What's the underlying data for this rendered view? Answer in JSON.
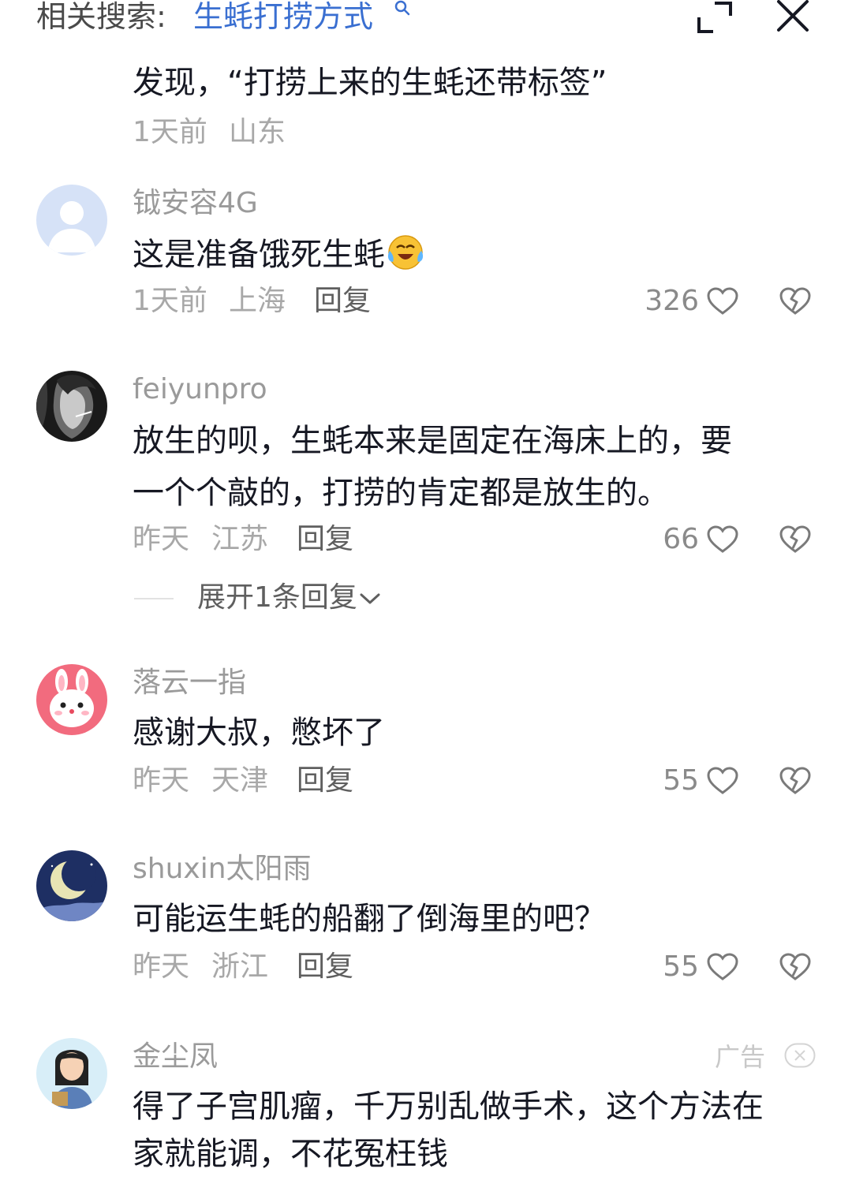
{
  "header": {
    "label": "相关搜索:",
    "query": "生蚝打捞方式",
    "icons": [
      "search-icon",
      "expand-icon",
      "close-icon"
    ]
  },
  "prev_comment": {
    "text": "发现，“打捞上来的生蚝还带标签”",
    "time": "1天前",
    "location": "山东"
  },
  "comments": [
    {
      "username": "钺安容4G",
      "text": "这是准备饿死生蚝",
      "emoji": "crying-laughing-emoji",
      "time": "1天前",
      "location": "上海",
      "reply": "回复",
      "likes": "326"
    },
    {
      "username": "feiyunpro",
      "text_lines": [
        "放生的呗，生蚝本来是固定在海床上的，要",
        "一个个敲的，打捞的肯定都是放生的。"
      ],
      "time": "昨天",
      "location": "江苏",
      "reply": "回复",
      "likes": "66",
      "expand": "展开1条回复"
    },
    {
      "username": "落云一指",
      "text": "感谢大叔，憋坏了",
      "time": "昨天",
      "location": "天津",
      "reply": "回复",
      "likes": "55"
    },
    {
      "username": "shuxin太阳雨",
      "text": "可能运生蚝的船翻了倒海里的吧？",
      "time": "昨天",
      "location": "浙江",
      "reply": "回复",
      "likes": "55"
    },
    {
      "username": "金尘凤",
      "text_lines": [
        "得了子宫肌瘤，千万别乱做手术，这个方法在",
        "家就能调，不花冤枉钱"
      ],
      "ad_label": "广告"
    }
  ],
  "colors": {
    "accent": "#3a6fd1",
    "text": "#161823",
    "meta": "#a8a8a8"
  }
}
